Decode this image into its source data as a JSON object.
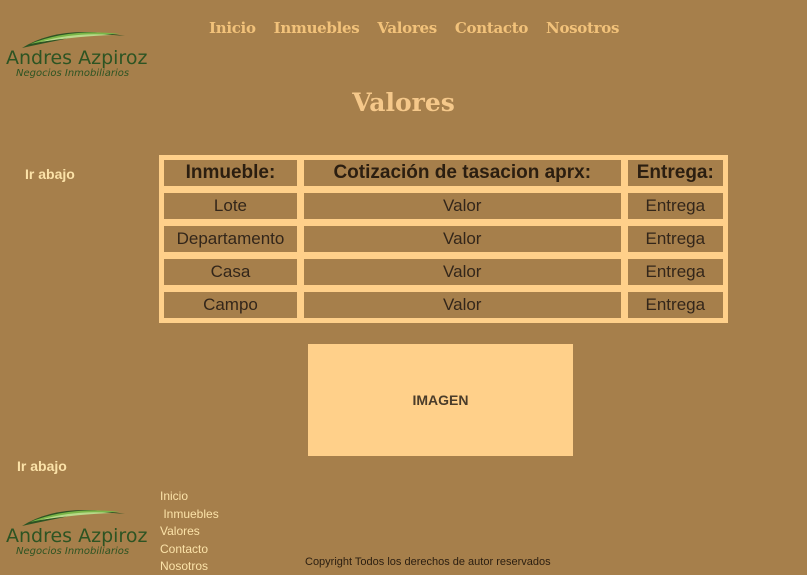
{
  "brand": {
    "name": "Andres Azpiroz",
    "tagline": "Negocios Inmobiliarios"
  },
  "nav": {
    "items": [
      "Inicio",
      "Inmuebles",
      "Valores",
      "Contacto",
      "Nosotros"
    ]
  },
  "page": {
    "title": "Valores",
    "ir_abajo": "Ir abajo"
  },
  "table": {
    "headers": [
      "Inmueble:",
      "Cotización de tasacion aprx:",
      "Entrega:"
    ],
    "rows": [
      [
        "Lote",
        "Valor",
        "Entrega"
      ],
      [
        "Departamento",
        "Valor",
        "Entrega"
      ],
      [
        "Casa",
        "Valor",
        "Entrega"
      ],
      [
        "Campo",
        "Valor",
        "Entrega"
      ]
    ]
  },
  "image_placeholder": "IMAGEN",
  "footer": {
    "ir_abajo": "Ir abajo",
    "nav": [
      "Inicio",
      " Inmuebles",
      "Valores",
      "Contacto",
      "Nosotros"
    ],
    "copyright": "Copyright Todos los derechos de autor reservados"
  },
  "colors": {
    "background": "#a67f4b",
    "accent": "#ffd08a",
    "logo_green": "#2d5423"
  }
}
